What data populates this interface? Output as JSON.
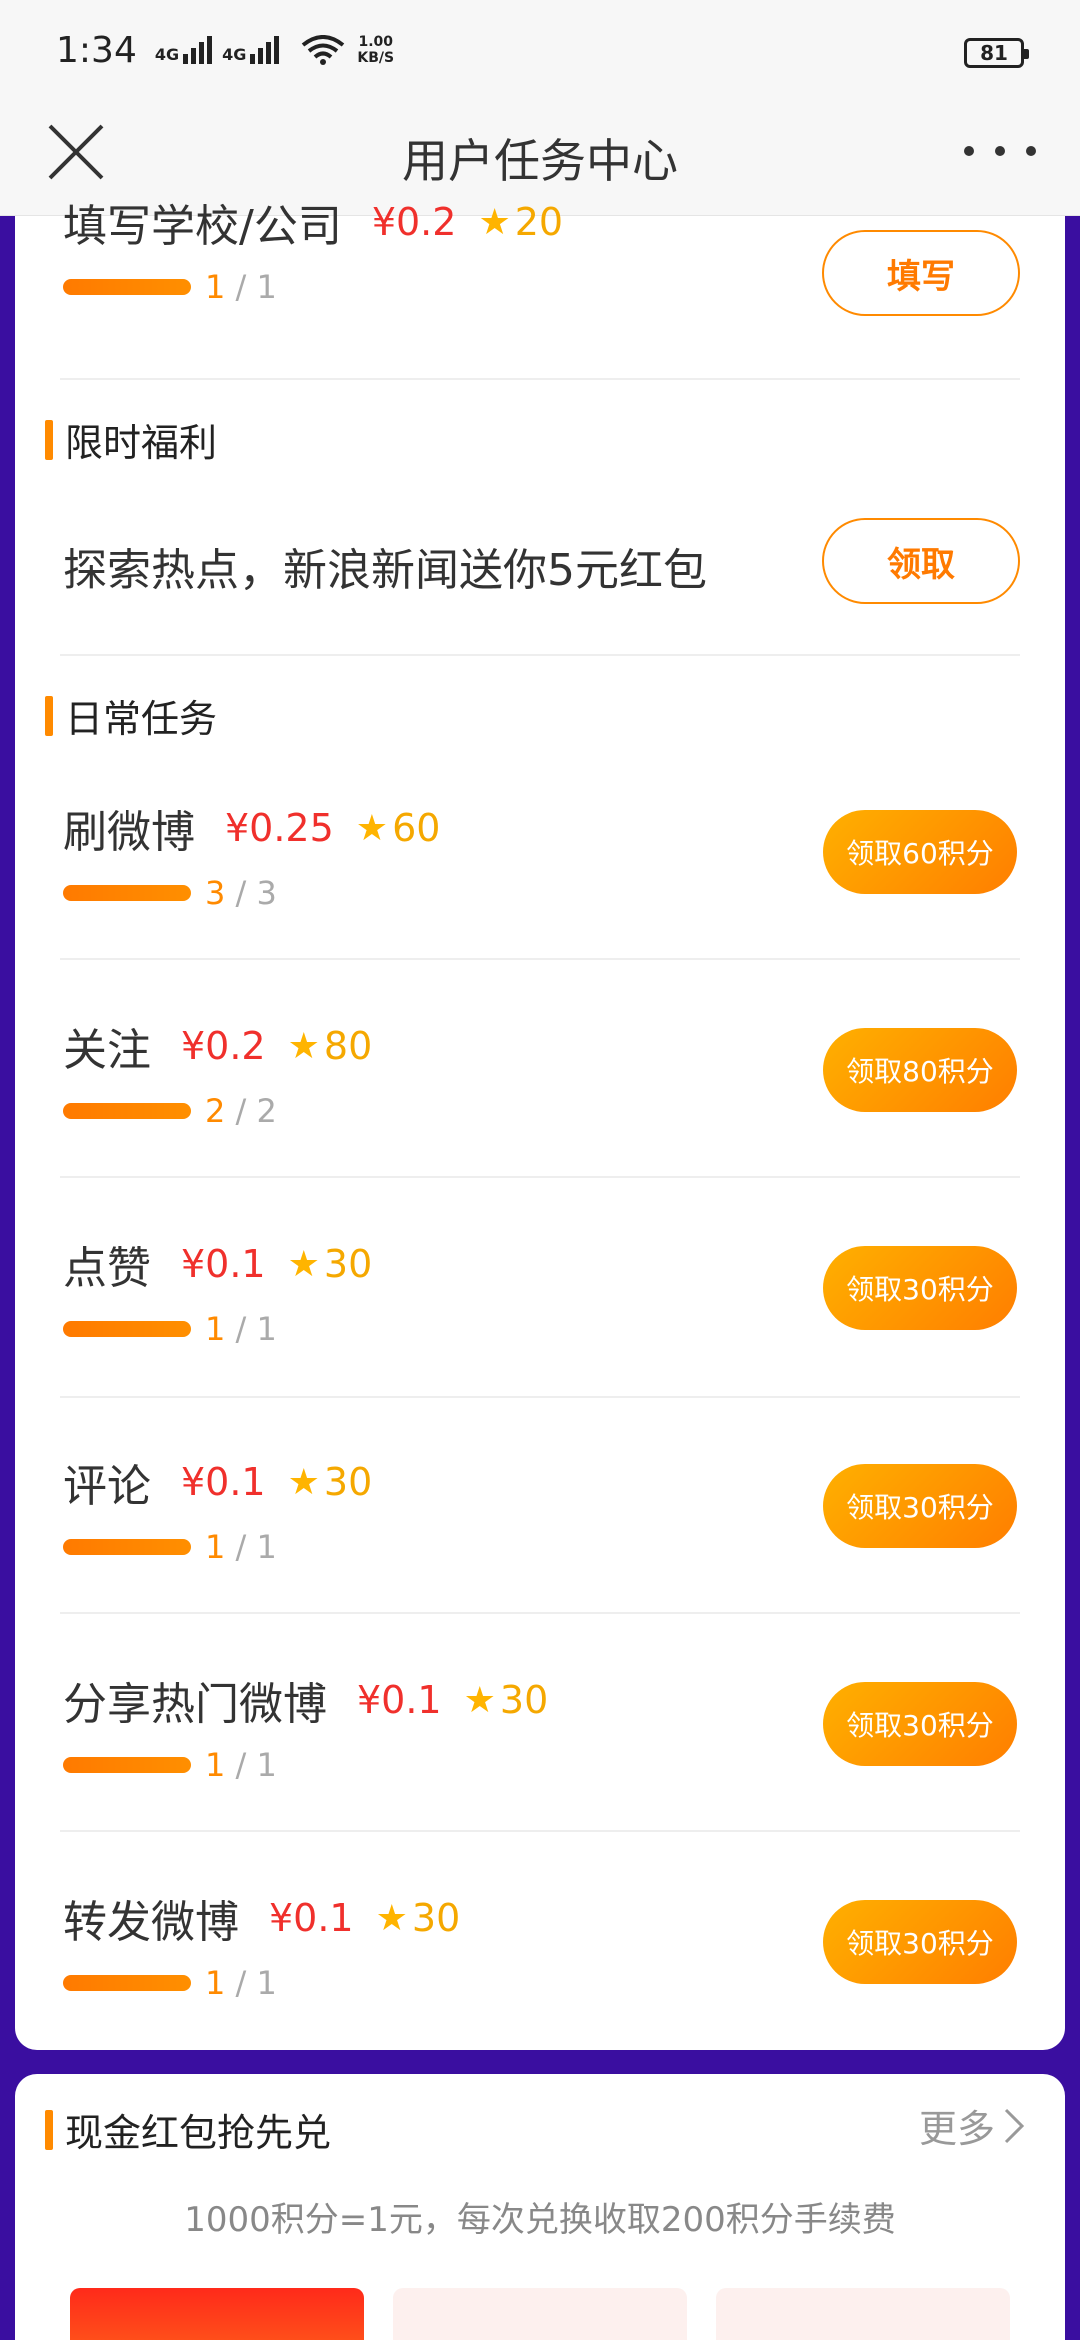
{
  "status": {
    "time": "1:34",
    "net1": "4G",
    "net2": "4G",
    "speed_value": "1.00",
    "speed_unit": "KB/S",
    "battery": "81"
  },
  "header": {
    "title": "用户任务中心"
  },
  "top_task": {
    "name": "填写学校/公司",
    "money": "¥0.2",
    "points": "20",
    "progress_done": "1",
    "progress_total": "/ 1",
    "button": "填写"
  },
  "limited": {
    "title": "限时福利",
    "promo_text": "探索热点，新浪新闻送你5元红包",
    "button": "领取"
  },
  "daily": {
    "title": "日常任务",
    "tasks": [
      {
        "name": "刷微博",
        "money": "¥0.25",
        "points": "60",
        "progress_done": "3",
        "progress_total": "/ 3",
        "button": "领取60积分"
      },
      {
        "name": "关注",
        "money": "¥0.2",
        "points": "80",
        "progress_done": "2",
        "progress_total": "/ 2",
        "button": "领取80积分"
      },
      {
        "name": "点赞",
        "money": "¥0.1",
        "points": "30",
        "progress_done": "1",
        "progress_total": "/ 1",
        "button": "领取30积分"
      },
      {
        "name": "评论",
        "money": "¥0.1",
        "points": "30",
        "progress_done": "1",
        "progress_total": "/ 1",
        "button": "领取30积分"
      },
      {
        "name": "分享热门微博",
        "money": "¥0.1",
        "points": "30",
        "progress_done": "1",
        "progress_total": "/ 1",
        "button": "领取30积分"
      },
      {
        "name": "转发微博",
        "money": "¥0.1",
        "points": "30",
        "progress_done": "1",
        "progress_total": "/ 1",
        "button": "领取30积分"
      }
    ]
  },
  "cash": {
    "title": "现金红包抢先兑",
    "more": "更多",
    "rule": "1000积分=1元，每次兑换收取200积分手续费"
  }
}
